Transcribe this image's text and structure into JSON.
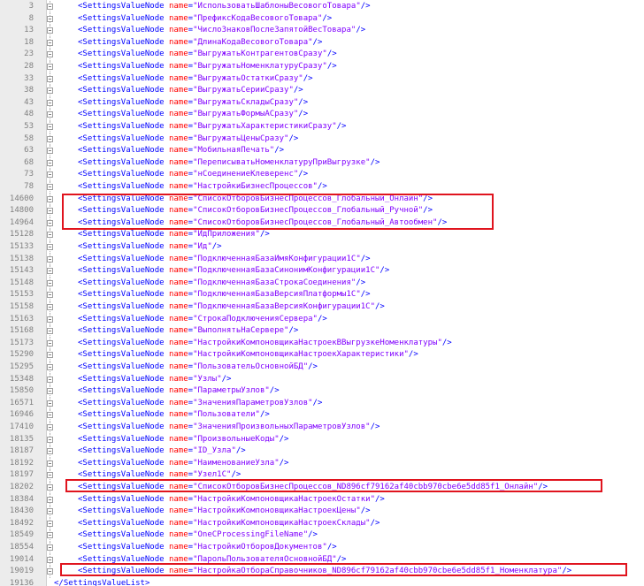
{
  "editor": {
    "language": "xml",
    "tag_open": "<",
    "tag_close_suffix": "/>",
    "element": "SettingsValueNode",
    "attr_name": "name",
    "closing_tag": "</SettingsValueList>",
    "colors": {
      "tag": "#0000ff",
      "attr": "#ff0000",
      "value": "#8000ff",
      "line_number": "#808080",
      "highlight": "#e0141e"
    },
    "lines": [
      {
        "num": "3",
        "value": "ИспользоватьШаблоныВесовогоТовара"
      },
      {
        "num": "8",
        "value": "ПрефиксКодаВесовогоТовара"
      },
      {
        "num": "13",
        "value": "ЧислоЗнаковПослеЗапятойВесТовара"
      },
      {
        "num": "18",
        "value": "ДлинаКодаВесовогоТовара"
      },
      {
        "num": "23",
        "value": "ВыгружатьКонтрагентовСразу"
      },
      {
        "num": "28",
        "value": "ВыгружатьНоменклатуруСразу"
      },
      {
        "num": "33",
        "value": "ВыгружатьОстаткиСразу"
      },
      {
        "num": "38",
        "value": "ВыгружатьСерииСразу"
      },
      {
        "num": "43",
        "value": "ВыгружатьСкладыСразу"
      },
      {
        "num": "48",
        "value": "ВыгружатьФормыАСразу"
      },
      {
        "num": "53",
        "value": "ВыгружатьХарактеристикиСразу"
      },
      {
        "num": "58",
        "value": "ВыгружатьЦеныСразу"
      },
      {
        "num": "63",
        "value": "МобильнаяПечать"
      },
      {
        "num": "68",
        "value": "ПереписыватьНоменклатуруПриВыгрузке"
      },
      {
        "num": "73",
        "value": "нСоединениеКлеверенс"
      },
      {
        "num": "78",
        "value": "НастройкиБизнесПроцессов"
      },
      {
        "num": "14600",
        "value": "СписокОтборовБизнесПроцессов_Глобальный_Онлайн"
      },
      {
        "num": "14800",
        "value": "СписокОтборовБизнесПроцессов_Глобальный_Ручной"
      },
      {
        "num": "14964",
        "value": "СписокОтборовБизнесПроцессов_Глобальный_Автообмен"
      },
      {
        "num": "15128",
        "value": "ИдПриложения"
      },
      {
        "num": "15133",
        "value": "Ид"
      },
      {
        "num": "15138",
        "value": "ПодключеннаяБазаИмяКонфигурации1С"
      },
      {
        "num": "15143",
        "value": "ПодключеннаяБазаСинонимКонфигурации1С"
      },
      {
        "num": "15148",
        "value": "ПодключеннаяБазаСтрокаСоединения"
      },
      {
        "num": "15153",
        "value": "ПодключеннаяБазаВерсияПлатформы1С"
      },
      {
        "num": "15158",
        "value": "ПодключеннаяБазаВерсияКонфигурации1С"
      },
      {
        "num": "15163",
        "value": "СтрокаПодключенияСервера"
      },
      {
        "num": "15168",
        "value": "ВыполнятьНаСервере"
      },
      {
        "num": "15173",
        "value": "НастройкиКомпоновщикаНастроекВВыгрузкеНоменклатуры"
      },
      {
        "num": "15290",
        "value": "НастройкиКомпоновщикаНастроекХарактеристики"
      },
      {
        "num": "15295",
        "value": "ПользовательОсновнойБД"
      },
      {
        "num": "15348",
        "value": "Узлы"
      },
      {
        "num": "15850",
        "value": "ПараметрыУзлов"
      },
      {
        "num": "16571",
        "value": "ЗначенияПараметровУзлов"
      },
      {
        "num": "16946",
        "value": "Пользователи"
      },
      {
        "num": "17410",
        "value": "ЗначенияПроизвольныхПараметровУзлов"
      },
      {
        "num": "18135",
        "value": "ПроизвольныеКоды"
      },
      {
        "num": "18187",
        "value": "ID_Узла"
      },
      {
        "num": "18192",
        "value": "НаименованиеУзла"
      },
      {
        "num": "18197",
        "value": "Узел1С"
      },
      {
        "num": "18202",
        "value": "СписокОтборовБизнесПроцессов_ND896cf79162af40cbb970cbe6e5dd85f1_Онлайн"
      },
      {
        "num": "18384",
        "value": "НастройкиКомпоновщикаНастроекОстатки"
      },
      {
        "num": "18430",
        "value": "НастройкиКомпоновщикаНастроекЦены"
      },
      {
        "num": "18492",
        "value": "НастройкиКомпоновщикаНастроекСклады"
      },
      {
        "num": "18549",
        "value": "OneCProcessingFileName"
      },
      {
        "num": "18554",
        "value": "НастройкиОтборовДокументов"
      },
      {
        "num": "19014",
        "value": "ПарольПользователяОсновнойБД"
      },
      {
        "num": "19019",
        "value": "НастройкаОтбораСправочников_ND896cf79162af40cbb970cbe6e5dd85f1_Номенклатура"
      }
    ],
    "last_line_num": "19136"
  }
}
